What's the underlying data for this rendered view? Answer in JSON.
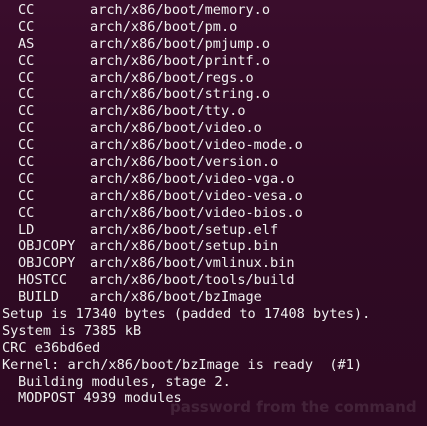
{
  "terminal": {
    "background": "#300a24",
    "foreground": "#f0f0f0",
    "build_lines": [
      {
        "cmd": "CC",
        "arg": "arch/x86/boot/memory.o"
      },
      {
        "cmd": "CC",
        "arg": "arch/x86/boot/pm.o"
      },
      {
        "cmd": "AS",
        "arg": "arch/x86/boot/pmjump.o"
      },
      {
        "cmd": "CC",
        "arg": "arch/x86/boot/printf.o"
      },
      {
        "cmd": "CC",
        "arg": "arch/x86/boot/regs.o"
      },
      {
        "cmd": "CC",
        "arg": "arch/x86/boot/string.o"
      },
      {
        "cmd": "CC",
        "arg": "arch/x86/boot/tty.o"
      },
      {
        "cmd": "CC",
        "arg": "arch/x86/boot/video.o"
      },
      {
        "cmd": "CC",
        "arg": "arch/x86/boot/video-mode.o"
      },
      {
        "cmd": "CC",
        "arg": "arch/x86/boot/version.o"
      },
      {
        "cmd": "CC",
        "arg": "arch/x86/boot/video-vga.o"
      },
      {
        "cmd": "CC",
        "arg": "arch/x86/boot/video-vesa.o"
      },
      {
        "cmd": "CC",
        "arg": "arch/x86/boot/video-bios.o"
      },
      {
        "cmd": "LD",
        "arg": "arch/x86/boot/setup.elf"
      },
      {
        "cmd": "OBJCOPY",
        "arg": "arch/x86/boot/setup.bin"
      },
      {
        "cmd": "OBJCOPY",
        "arg": "arch/x86/boot/vmlinux.bin"
      },
      {
        "cmd": "HOSTCC",
        "arg": "arch/x86/boot/tools/build"
      },
      {
        "cmd": "BUILD",
        "arg": "arch/x86/boot/bzImage"
      }
    ],
    "setup_line": "Setup is 17340 bytes (padded to 17408 bytes).",
    "system_line": "System is 7385 kB",
    "crc_line": "CRC e36bd6ed",
    "kernel_line": "Kernel: arch/x86/boot/bzImage is ready  (#1)",
    "modules_line": "Building modules, stage 2.",
    "modpost_line": "MODPOST 4939 modules"
  },
  "background_ghost": {
    "password_heading": "password from the command"
  }
}
